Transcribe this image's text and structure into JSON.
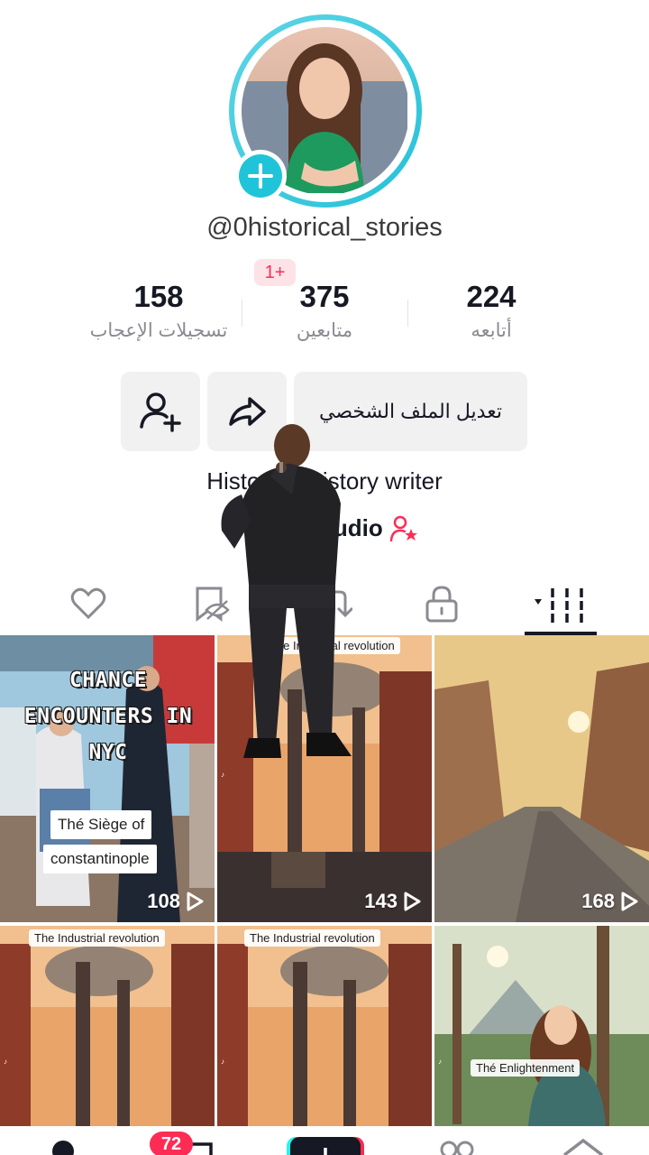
{
  "profile": {
    "username": "@0historical_stories",
    "new_badge": "1+",
    "stats": [
      {
        "value": "224",
        "label": "أتابعه"
      },
      {
        "value": "375",
        "label": "متابعين"
      },
      {
        "value": "158",
        "label": "تسجيلات الإعجاب"
      }
    ],
    "edit_profile_label": "تعديل الملف الشخصي",
    "bio": "Historical history writer",
    "studio_label": "TikTok Studio"
  },
  "grid": [
    {
      "title_big": "CHANCE ENCOUNTERS IN NYC",
      "subtitle_1": "Thé Siège of",
      "subtitle_2": "constantinople",
      "views": "108"
    },
    {
      "caption": "The Industrial revolution",
      "views": "143"
    },
    {
      "views": "168"
    },
    {
      "caption": "The Industrial revolution"
    },
    {
      "caption": "The Industrial revolution"
    },
    {
      "caption": "Thé Enlightenment"
    }
  ],
  "nav": {
    "notification_count": "72"
  },
  "colors": {
    "accent": "#fe2c55",
    "avatar_ring": "#25c1d8",
    "button_bg": "#f1f1f2"
  }
}
